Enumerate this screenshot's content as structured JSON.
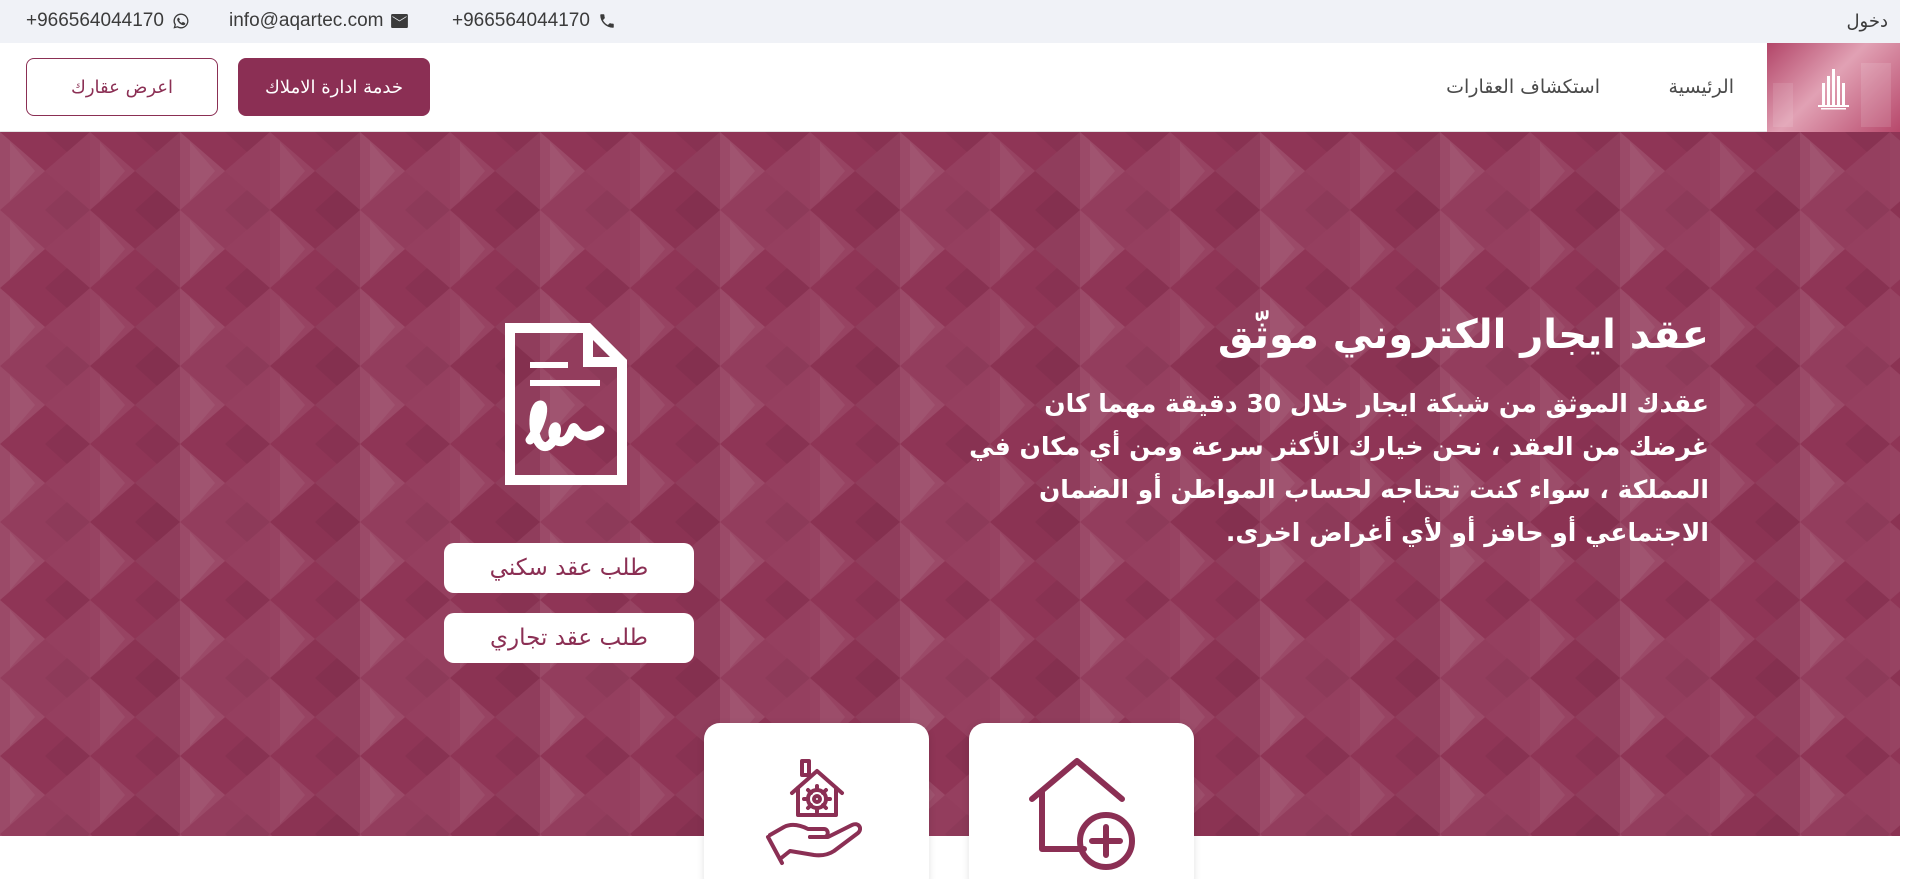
{
  "topbar": {
    "whatsapp_phone": "+966564044170",
    "email": "info@aqartec.com",
    "phone": "+966564044170",
    "login": "دخول"
  },
  "navbar": {
    "home": "الرئيسية",
    "explore": "استكشاف العقارات",
    "property_management_button": "خدمة ادارة الاملاك",
    "list_property_button": "اعرض عقارك"
  },
  "hero": {
    "title": "عقد ايجار الكتروني موثّق",
    "description": "عقدك الموثق من شبكة ايجار خلال 30 دقيقة مهما كان غرضك من العقد ، نحن خيارك الأكثر سرعة ومن أي مكان في المملكة ، سواء كنت تحتاجه لحساب المواطن أو الضمان الاجتماعي أو حافز أو لأي أغراض اخرى.",
    "residential_button": "طلب عقد سكني",
    "commercial_button": "طلب عقد تجاري"
  },
  "icons": {
    "whatsapp": "whatsapp-icon",
    "email": "envelope-icon",
    "phone": "phone-icon",
    "document": "signed-document-icon",
    "property_management": "hand-house-gear-icon",
    "add_property": "house-plus-icon"
  },
  "colors": {
    "brand": "#8b2f54",
    "hero_background": "#8f3556",
    "topbar_background": "#f0f2f7"
  }
}
